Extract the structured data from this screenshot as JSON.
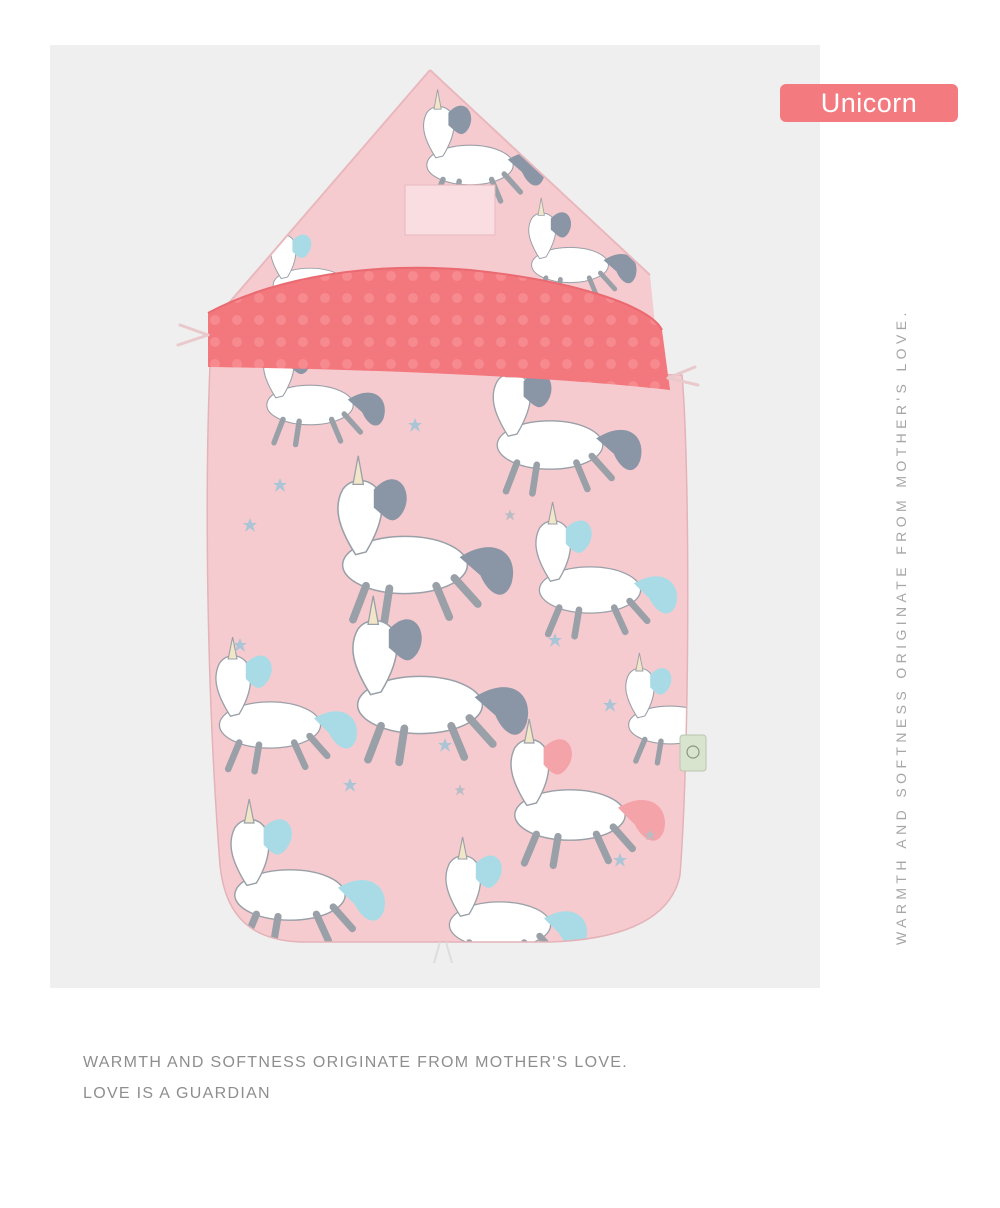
{
  "product": {
    "variant_badge": "Unicorn",
    "vertical_tagline": "WARMTH AND SOFTNESS ORIGINATE FROM MOTHER'S LOVE.",
    "image_icon": "unicorn-sleeping-bag-illustration"
  },
  "captions": {
    "line1": "WARMTH AND SOFTNESS ORIGINATE FROM MOTHER'S LOVE.",
    "line2": "LOVE IS A GUARDIAN"
  },
  "colors": {
    "badge": "#f37b80",
    "fabric": "#f6cbcf",
    "lining": "#f2787e",
    "panel": "#efeff0"
  }
}
